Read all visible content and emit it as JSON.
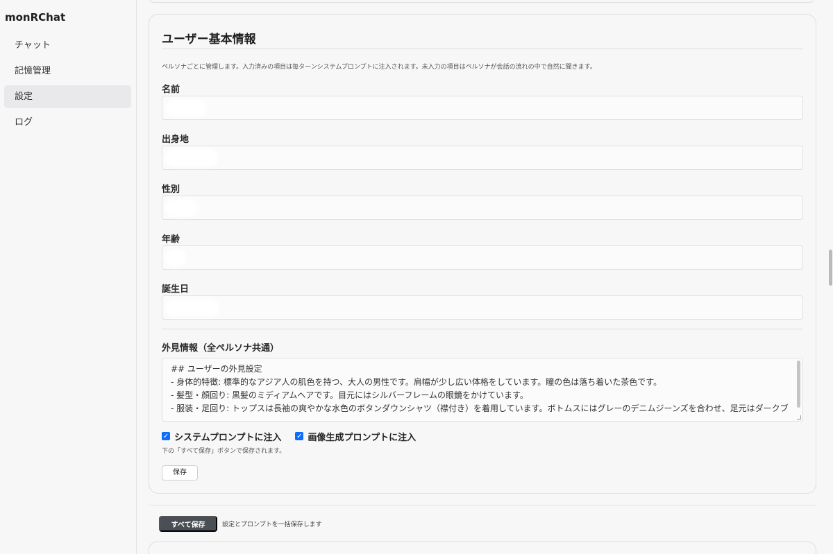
{
  "app": {
    "brand": "monRChat"
  },
  "sidebar": {
    "items": [
      {
        "label": "チャット",
        "active": false
      },
      {
        "label": "記憶管理",
        "active": false
      },
      {
        "label": "設定",
        "active": true
      },
      {
        "label": "ログ",
        "active": false
      }
    ]
  },
  "card": {
    "title": "ユーザー基本情報",
    "description": "ペルソナごとに管理します。入力済みの項目は毎ターンシステムプロンプトに注入されます。未入力の項目はペルソナが会話の流れの中で自然に聞きます。",
    "fields": [
      {
        "label": "名前",
        "value": ""
      },
      {
        "label": "出身地",
        "value": ""
      },
      {
        "label": "性別",
        "value": ""
      },
      {
        "label": "年齢",
        "value": ""
      },
      {
        "label": "誕生日",
        "value": ""
      }
    ],
    "appearance": {
      "label": "外見情報（全ペルソナ共通）",
      "lines": [
        "## ユーザーの外見設定",
        "- 身体的特徴: 標準的なアジア人の肌色を持つ、大人の男性です。肩幅が少し広い体格をしています。瞳の色は落ち着いた茶色です。",
        "- 髪型・顔回り: 黒髪のミディアムヘアです。目元にはシルバーフレームの眼鏡をかけています。",
        "- 服装・足回り: トップスは長袖の爽やかな水色のボタンダウンシャツ（襟付き）を着用しています。ボトムスにはグレーのデニムジーンズを合わせ、足元はダークブラウン（焦げ茶色）のレイキングブーツ（トレッキングシューズ）を履いた、動きやすくアクティブなスタイルです。"
      ]
    },
    "checkboxes": [
      {
        "label": "システムプロンプトに注入",
        "checked": true
      },
      {
        "label": "画像生成プロンプトに注入",
        "checked": true
      }
    ],
    "note": "下の「すべて保存」ボタンで保存されます。",
    "save_label": "保存"
  },
  "footer": {
    "save_all_label": "すべて保存",
    "save_all_note": "設定とプロンプトを一括保存します"
  },
  "colors": {
    "accent": "#0d6efd",
    "primary_button": "#4a4f56"
  }
}
